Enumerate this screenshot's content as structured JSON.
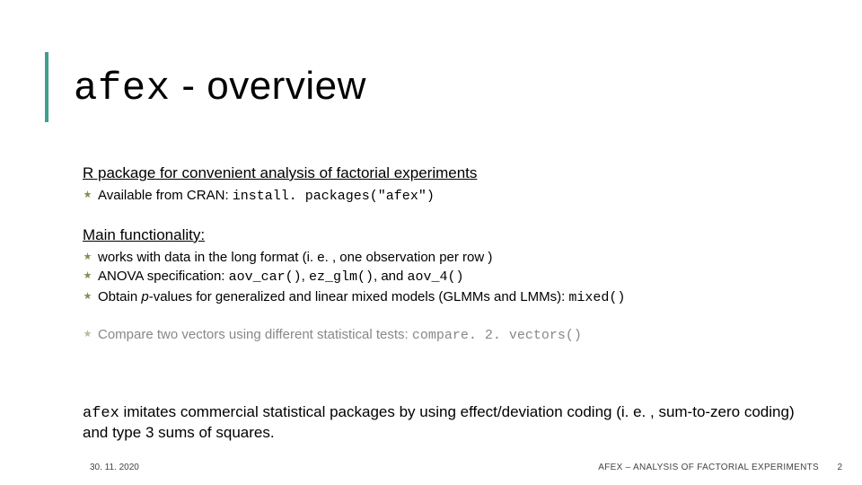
{
  "title": {
    "mono": "afex",
    "rest": " - overview"
  },
  "sec1": {
    "lead": "R package for convenient analysis of factorial experiments",
    "b1_text": "Available from CRAN: ",
    "b1_code": "install. packages(\"afex\")"
  },
  "sec2": {
    "lead": "Main functionality:",
    "b1": "works with data in the long format (i. e. , one observation per row )",
    "b2_a": "ANOVA specification: ",
    "b2_c1": "aov_car()",
    "b2_s1": ", ",
    "b2_c2": "ez_glm()",
    "b2_s2": ", and ",
    "b2_c3": "aov_4()",
    "b3_a": "Obtain ",
    "b3_i": "p",
    "b3_b": "-values for generalized and linear mixed models (GLMMs and LMMs): ",
    "b3_c": "mixed()"
  },
  "sec3": {
    "b1_a": "Compare two vectors using different statistical tests: ",
    "b1_c": "compare. 2. vectors()"
  },
  "closing": {
    "mono": "afex",
    "rest": " imitates commercial statistical packages by using effect/deviation coding (i. e. , sum-to-zero coding) and type 3 sums of squares."
  },
  "footer": {
    "date": "30. 11. 2020",
    "title": "AFEX – ANALYSIS OF FACTORIAL EXPERIMENTS",
    "page": "2"
  },
  "colors": {
    "accent": "#3e9e8f",
    "faded": "#888888"
  }
}
